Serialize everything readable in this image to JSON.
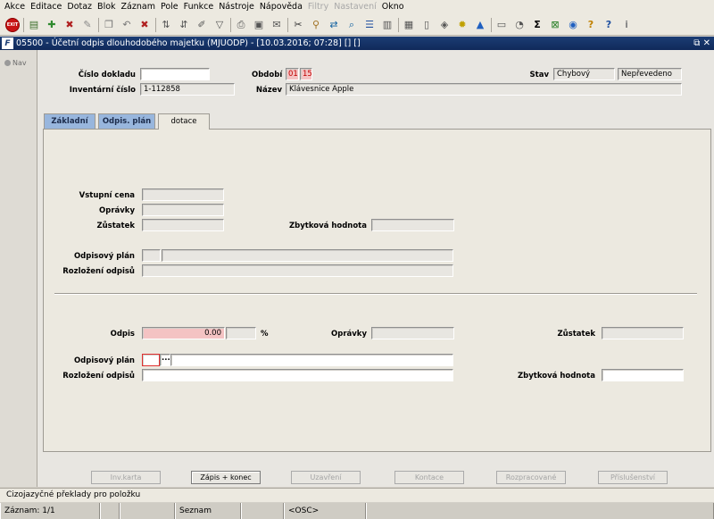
{
  "menu": [
    "Akce",
    "Editace",
    "Dotaz",
    "Blok",
    "Záznam",
    "Pole",
    "Funkce",
    "Nástroje",
    "Nápověda",
    "Filtry",
    "Nastavení",
    "Okno"
  ],
  "menu_disabled": [
    "Filtry",
    "Nastavení"
  ],
  "toolbar": {
    "exit_label": "EXIT",
    "buttons": [
      "save-icon",
      "insert-record-icon",
      "delete-record-icon",
      "clear-icon",
      "copy-icon",
      "undo-icon",
      "delete-icon",
      "sort-asc-icon",
      "sort-desc-icon",
      "edit-icon",
      "filter-icon",
      "print-icon",
      "preview-icon",
      "mail-icon",
      "cut-icon",
      "find-icon",
      "replace-icon",
      "search-icon",
      "list-icon",
      "columns-icon",
      "calculator-icon",
      "document-icon",
      "hide-icon",
      "star-icon",
      "warning-icon",
      "form-icon",
      "chart-icon",
      "sum-icon",
      "excel-icon",
      "web-icon",
      "help-icon",
      "question-icon",
      "info-icon"
    ],
    "sum_glyph": "Σ"
  },
  "window": {
    "app_icon_text": "F",
    "title": "05500 - Účetní odpis dlouhodobého majetku (MJUODP) - [10.03.2016; 07:28] [] []",
    "controls": "⧉ ✕"
  },
  "nav": {
    "label": "Nav"
  },
  "header": {
    "cislo_dokladu_label": "Číslo dokladu",
    "cislo_dokladu_value": "",
    "inventarni_cislo_label": "Inventární číslo",
    "inventarni_cislo_value": "1-112858",
    "obdobi_label": "Období",
    "obdobi_month": "01",
    "obdobi_year": "15",
    "nazev_label": "Název",
    "nazev_value": "Klávesnice Apple",
    "stav_label": "Stav",
    "stav_value1": "Chybový",
    "stav_value2": "Nepřevedeno"
  },
  "tabs": [
    {
      "label": "Základní",
      "active": false
    },
    {
      "label": "Odpis. plán",
      "active": false
    },
    {
      "label": "dotace",
      "active": true
    }
  ],
  "section1": {
    "vstupni_cena_label": "Vstupní cena",
    "opravky_label": "Oprávky",
    "zustatek_label": "Zůstatek",
    "zbytkova_label": "Zbytková hodnota",
    "odpisovy_plan_label": "Odpisový plán",
    "rozlozeni_label": "Rozložení odpisů"
  },
  "section2": {
    "odpis_label": "Odpis",
    "odpis_value": "0.00",
    "percent_label": "%",
    "opravky_label": "Oprávky",
    "zustatek_label": "Zůstatek",
    "odpisovy_plan_label": "Odpisový plán",
    "lov_button": "...",
    "rozlozeni_label": "Rozložení odpisů",
    "zbytkova_label": "Zbytková hodnota"
  },
  "buttons": [
    {
      "label": "Inv.karta",
      "enabled": false
    },
    {
      "label": "Zápis + konec",
      "enabled": true
    },
    {
      "label": "Uzavření",
      "enabled": false
    },
    {
      "label": "Kontace",
      "enabled": false
    },
    {
      "label": "Rozpracované",
      "enabled": false
    },
    {
      "label": "Příslušenství",
      "enabled": false
    }
  ],
  "hint": "Cizojazyčné překlady pro položku",
  "status": {
    "record": "Záznam: 1/1",
    "list": "Seznam hodn...",
    "osc": "<OSC>"
  }
}
